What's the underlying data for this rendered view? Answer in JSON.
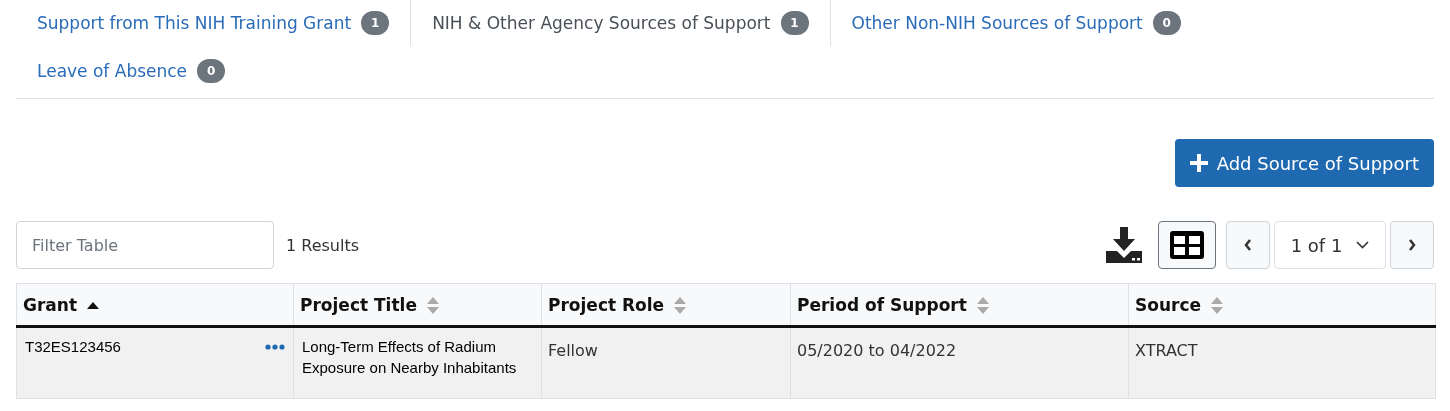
{
  "tabs": [
    {
      "label": "Support from This NIH Training Grant",
      "count": "1",
      "selected": false
    },
    {
      "label": "NIH & Other Agency Sources of Support",
      "count": "1",
      "selected": true
    },
    {
      "label": "Other Non-NIH Sources of Support",
      "count": "0",
      "selected": false
    },
    {
      "label": "Leave of Absence",
      "count": "0",
      "selected": false
    }
  ],
  "add_button": {
    "label": "Add Source of Support"
  },
  "filter": {
    "placeholder": "Filter Table"
  },
  "results": "1 Results",
  "pagination": {
    "page": "1 of 1"
  },
  "table": {
    "columns": [
      {
        "label": "Grant",
        "sorted": true
      },
      {
        "label": "Project Title",
        "sorted": false
      },
      {
        "label": "Project Role",
        "sorted": false
      },
      {
        "label": "Period of Support",
        "sorted": false
      },
      {
        "label": "Source",
        "sorted": false
      }
    ],
    "rows": [
      {
        "cells": [
          "T32ES123456",
          "Long-Term Effects of Radium Exposure on Nearby Inhabitants",
          "Fellow",
          "05/2020 to 04/2022",
          "XTRACT"
        ]
      }
    ]
  }
}
